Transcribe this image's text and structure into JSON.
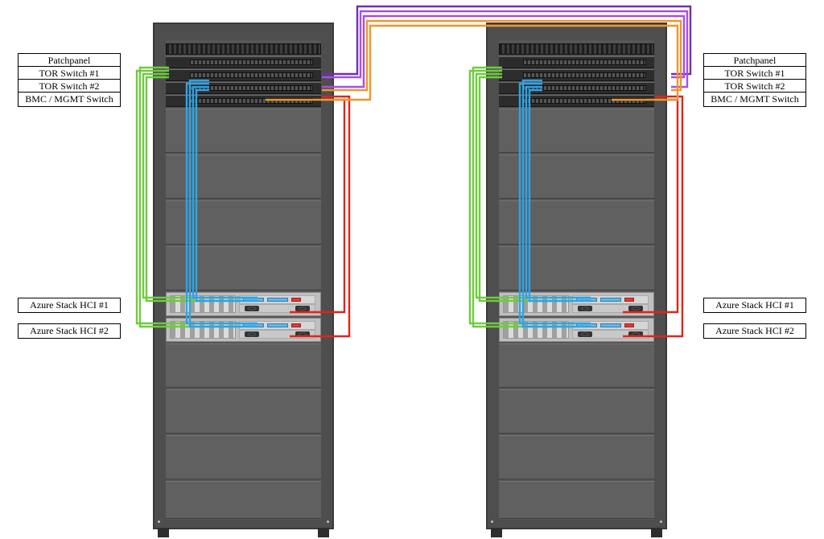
{
  "racks": {
    "left": {
      "patchpanel": "Patchpanel",
      "tor1": "TOR Switch #1",
      "tor2": "TOR Switch #2",
      "bmc": "BMC / MGMT Switch",
      "hci1": "Azure Stack HCI #1",
      "hci2": "Azure Stack HCI #2"
    },
    "right": {
      "patchpanel": "Patchpanel",
      "tor1": "TOR Switch #1",
      "tor2": "TOR Switch #2",
      "bmc": "BMC / MGMT Switch",
      "hci1": "Azure Stack HCI #1",
      "hci2": "Azure Stack HCI #2"
    }
  },
  "cable_colors": {
    "hci_to_tor1": "#6fcb3f",
    "hci_to_tor2": "#2ea3e6",
    "hci_to_bmc": "#e2231a",
    "interrack_tor1_to_tor1": "#6d2fb6",
    "interrack_tor1_to_tor2": "#a84fe0",
    "interrack_tor2_to_tor2": "#f0962b",
    "interrack_bmc_to_bmc": "#f0962b"
  }
}
